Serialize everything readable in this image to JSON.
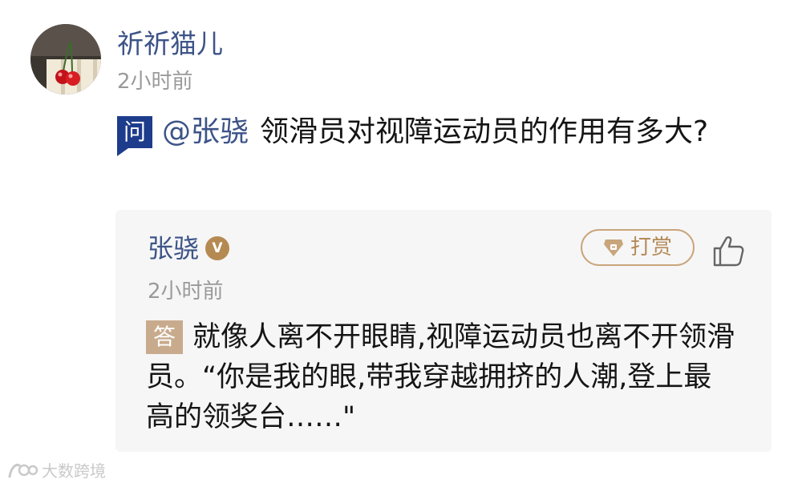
{
  "post": {
    "author": {
      "name": "祈祈猫儿",
      "timestamp": "2小时前",
      "avatar_icon": "cherry-avatar"
    },
    "question": {
      "badge": "问",
      "mention": "@张骁",
      "text": "领滑员对视障运动员的作用有多大?"
    }
  },
  "answer": {
    "author": {
      "name": "张骁",
      "verified_badge": "V",
      "timestamp": "2小时前"
    },
    "tip_button": {
      "label": "打赏",
      "icon": "gem-icon"
    },
    "like_icon": "thumbs-up-icon",
    "badge": "答",
    "text": "就像人离不开眼睛,视障运动员也离不开领滑员。“你是我的眼,带我穿越拥挤的人潮,登上最高的领奖台……\""
  },
  "watermark": {
    "logo_icon": "sports-logo-icon",
    "text": "大数跨境"
  },
  "colors": {
    "link_blue": "#3d5488",
    "question_badge": "#1e3c8c",
    "answer_badge": "#c8ab8c",
    "tip_gold": "#c9a57c",
    "muted_gray": "#9a9a9a",
    "card_bg": "#f6f6f6"
  }
}
